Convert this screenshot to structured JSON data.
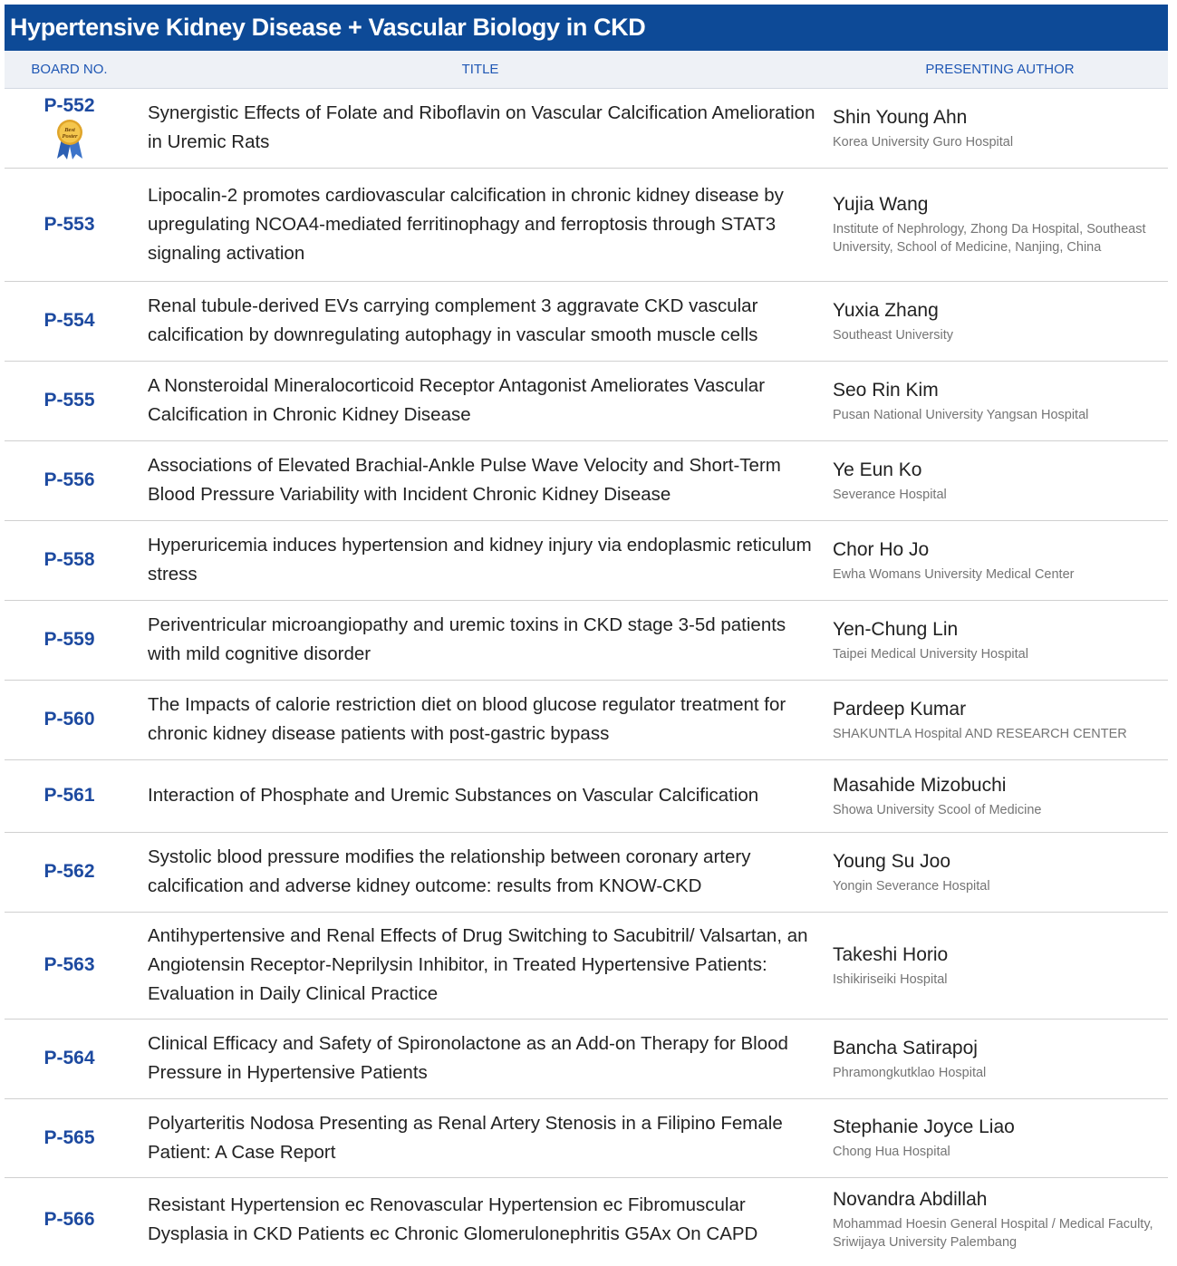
{
  "header": {
    "title": "Hypertensive Kidney Disease + Vascular Biology in CKD"
  },
  "columns": {
    "board": "BOARD NO.",
    "title": "TITLE",
    "author": "PRESENTING AUTHOR"
  },
  "badge": {
    "text_line1": "Best",
    "text_line2": "Poster"
  },
  "rows": [
    {
      "board": "P-552",
      "title": "Synergistic Effects of Folate and Riboflavin on Vascular Calcification Amelioration in Uremic Rats",
      "author": "Shin Young Ahn",
      "affiliation": "Korea University Guro Hospital"
    },
    {
      "board": "P-553",
      "title": "Lipocalin-2 promotes cardiovascular calcification in chronic kidney disease by upregulating NCOA4-mediated ferritinophagy and ferroptosis through STAT3 signaling activation",
      "author": "Yujia Wang",
      "affiliation": "Institute of Nephrology, Zhong Da Hospital, Southeast University, School of Medicine, Nanjing, China"
    },
    {
      "board": "P-554",
      "title": "Renal tubule-derived EVs carrying complement 3 aggravate CKD vascular calcification by downregulating autophagy in vascular smooth muscle cells",
      "author": "Yuxia Zhang",
      "affiliation": "Southeast University"
    },
    {
      "board": "P-555",
      "title": "A Nonsteroidal Mineralocorticoid Receptor Antagonist Ameliorates Vascular Calcification in Chronic Kidney Disease",
      "author": "Seo Rin Kim",
      "affiliation": "Pusan National University Yangsan Hospital"
    },
    {
      "board": "P-556",
      "title": "Associations of Elevated Brachial-Ankle Pulse Wave Velocity and Short-Term Blood Pressure Variability with Incident Chronic Kidney Disease",
      "author": "Ye Eun Ko",
      "affiliation": "Severance Hospital"
    },
    {
      "board": "P-558",
      "title": "Hyperuricemia induces hypertension and kidney injury via endoplasmic reticulum stress",
      "author": "Chor Ho Jo",
      "affiliation": "Ewha Womans University Medical Center"
    },
    {
      "board": "P-559",
      "title": "Periventricular microangiopathy and uremic toxins in CKD stage 3-5d patients with mild cognitive disorder",
      "author": "Yen-Chung Lin",
      "affiliation": "Taipei Medical University Hospital"
    },
    {
      "board": "P-560",
      "title": "The Impacts of calorie restriction diet on blood glucose regulator treatment for chronic kidney disease patients with post-gastric bypass",
      "author": "Pardeep Kumar",
      "affiliation": "SHAKUNTLA Hospital AND RESEARCH CENTER"
    },
    {
      "board": "P-561",
      "title": "Interaction of Phosphate and Uremic Substances on Vascular Calcification",
      "author": "Masahide Mizobuchi",
      "affiliation": "Showa University Scool of Medicine"
    },
    {
      "board": "P-562",
      "title": "Systolic blood pressure modifies the relationship between coronary artery calcification and adverse kidney outcome: results from KNOW-CKD",
      "author": "Young Su Joo",
      "affiliation": "Yongin Severance Hospital"
    },
    {
      "board": "P-563",
      "title": "Antihypertensive and Renal Effects of Drug Switching to Sacubitril/ Valsartan, an Angiotensin Receptor-Neprilysin Inhibitor, in Treated Hypertensive Patients: Evaluation in Daily Clinical Practice",
      "author": "Takeshi Horio",
      "affiliation": "Ishikiriseiki Hospital"
    },
    {
      "board": "P-564",
      "title": "Clinical Efficacy and Safety of Spironolactone as an Add-on Therapy for Blood Pressure in Hypertensive Patients",
      "author": "Bancha Satirapoj",
      "affiliation": "Phramongkutklao Hospital"
    },
    {
      "board": "P-565",
      "title": "Polyarteritis Nodosa Presenting as Renal Artery Stenosis in a Filipino Female Patient: A Case Report",
      "author": "Stephanie Joyce Liao",
      "affiliation": "Chong Hua Hospital"
    },
    {
      "board": "P-566",
      "title": "Resistant Hypertension ec Renovascular Hypertension ec Fibromuscular Dysplasia in CKD Patients ec Chronic Glomerulonephritis G5Ax On CAPD",
      "author": "Novandra Abdillah",
      "affiliation": "Mohammad Hoesin General Hospital / Medical Faculty, Sriwijaya University Palembang"
    }
  ]
}
